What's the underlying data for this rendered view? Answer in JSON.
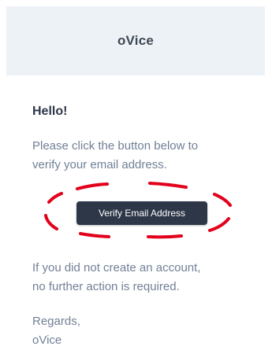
{
  "header": {
    "brand": "oVice"
  },
  "email": {
    "greeting": "Hello!",
    "intro_line1": "Please click the button below to",
    "intro_line2": "verify your email address.",
    "button_label": "Verify Email Address",
    "outro_line1": "If you did not create an account,",
    "outro_line2": "no further action is required.",
    "salutation": "Regards,",
    "signature": "oVice"
  },
  "colors": {
    "header_bg": "#edf2f7",
    "button_bg": "#2d3748",
    "body_text": "#718096",
    "annotation": "#e3001b"
  }
}
